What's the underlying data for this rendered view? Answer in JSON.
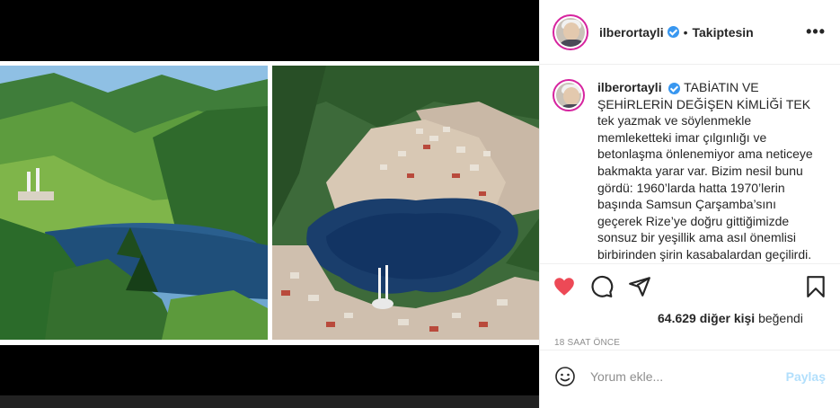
{
  "post": {
    "username": "ilberortayli",
    "follow_state": "Takiptesin",
    "separator": "•",
    "more_icon": "more-options-icon"
  },
  "caption": {
    "username": "ilberortayli",
    "title": "TABİATIN VE ŞEHİRLERİN DEĞİŞEN KİMLİĞİ",
    "body": "TEK tek yazmak ve söylenmekle memleketteki imar çılgınlığı ve betonlaşma önlenemiyor ama neticeye bakmakta yarar var. Bizim nesil bunu gördü: 1960’larda hatta 1970’lerin başında Samsun Çarşamba’sını geçerek Rize’ye doğru gittiğimizde sonsuz bir yeşillik ama asıl önemlisi birbirinden şirin kasabalardan geçilirdi."
  },
  "actions": {
    "like_icon": "heart-icon",
    "comment_icon": "comment-icon",
    "share_icon": "share-icon",
    "save_icon": "bookmark-icon",
    "like_color": "#ed4956"
  },
  "likes": {
    "count": "64.629",
    "suffix_bold": "diğer kişi",
    "suffix": " beğendi"
  },
  "timestamp": "18 SAAT ÖNCE",
  "comment": {
    "placeholder": "Yorum ekle...",
    "post_label": "Paylaş",
    "post_color": "#b2dffc"
  }
}
